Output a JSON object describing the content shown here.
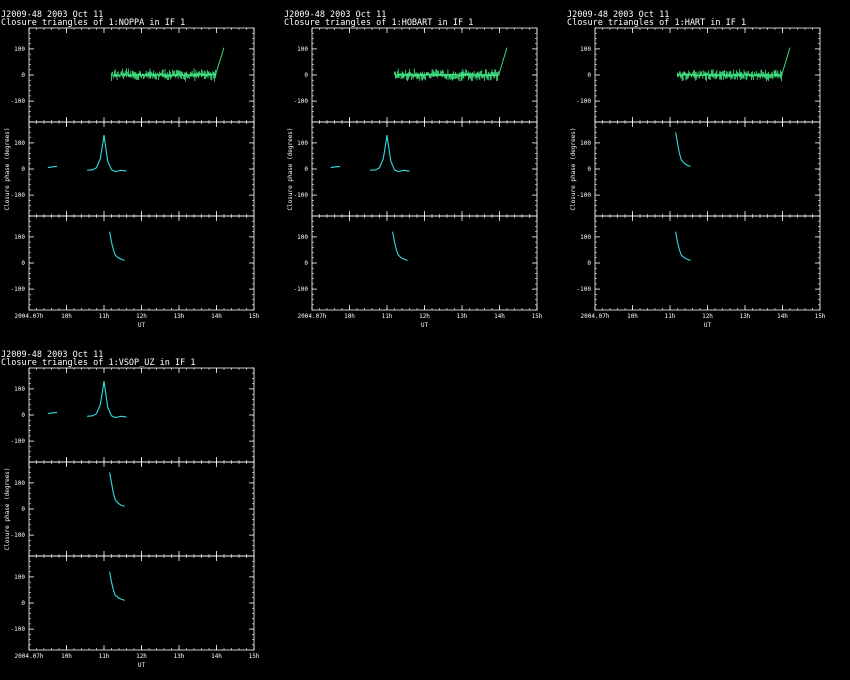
{
  "colors": {
    "background": "#000000",
    "axis": "#ffffff",
    "series_green": "#44ee88",
    "series_cyan": "#33dddd"
  },
  "y_label": "Closure phase  (degrees)",
  "x_label": "UT",
  "x_ticks": [
    {
      "v": 9.0,
      "label": "2004.07h"
    },
    {
      "v": 10.0,
      "label": "10h"
    },
    {
      "v": 11.0,
      "label": "11h"
    },
    {
      "v": 12.0,
      "label": "12h"
    },
    {
      "v": 13.0,
      "label": "13h"
    },
    {
      "v": 14.0,
      "label": "14h"
    },
    {
      "v": 15.0,
      "label": "15h"
    }
  ],
  "y_ticks": [
    100,
    0,
    -100
  ],
  "chart_data": [
    {
      "type": "line",
      "title_line1": "J2009-48   2003 Oct 11",
      "title_line2": "Closure triangles of 1:NOPPA in IF 1",
      "xlim": [
        9.0,
        15.0
      ],
      "ylim": [
        -180,
        180
      ],
      "panels": [
        {
          "label": "",
          "color": "green",
          "series": "noisy_ramp"
        },
        {
          "label": "",
          "color": "cyan",
          "series": "peak"
        },
        {
          "label": "",
          "color": "cyan",
          "series": "decay"
        }
      ]
    },
    {
      "type": "line",
      "title_line1": "J2009-48   2003 Oct 11",
      "title_line2": "Closure triangles of 1:HOBART in IF 1",
      "xlim": [
        9.0,
        15.0
      ],
      "ylim": [
        -180,
        180
      ],
      "panels": [
        {
          "label": "",
          "color": "green",
          "series": "noisy_ramp"
        },
        {
          "label": "",
          "color": "cyan",
          "series": "peak"
        },
        {
          "label": "",
          "color": "cyan",
          "series": "decay"
        }
      ]
    },
    {
      "type": "line",
      "title_line1": "J2009-48   2003 Oct 11",
      "title_line2": "Closure triangles of 1:HART in IF 1",
      "xlim": [
        9.0,
        15.0
      ],
      "ylim": [
        -180,
        180
      ],
      "panels": [
        {
          "label": "",
          "color": "green",
          "series": "noisy_ramp"
        },
        {
          "label": "",
          "color": "cyan",
          "series": "decay_high"
        },
        {
          "label": "",
          "color": "cyan",
          "series": "decay"
        }
      ]
    },
    {
      "type": "line",
      "title_line1": "J2009-48   2003 Oct 11",
      "title_line2": "Closure triangles of 1:VSOP_UZ in IF 1",
      "xlim": [
        9.0,
        15.0
      ],
      "ylim": [
        -180,
        180
      ],
      "panels": [
        {
          "label": "",
          "color": "cyan",
          "series": "peak"
        },
        {
          "label": "",
          "color": "cyan",
          "series": "decay_high"
        },
        {
          "label": "",
          "color": "cyan",
          "series": "decay"
        }
      ]
    }
  ],
  "series_defs": {
    "peak": {
      "segments": [
        [
          [
            9.5,
            5
          ],
          [
            9.6,
            8
          ],
          [
            9.75,
            10
          ]
        ],
        [
          [
            10.55,
            -5
          ],
          [
            10.7,
            -3
          ],
          [
            10.8,
            5
          ],
          [
            10.9,
            40
          ],
          [
            10.97,
            100
          ],
          [
            11.0,
            130
          ],
          [
            11.03,
            100
          ],
          [
            11.1,
            30
          ],
          [
            11.2,
            -3
          ],
          [
            11.3,
            -10
          ],
          [
            11.45,
            -5
          ],
          [
            11.6,
            -8
          ]
        ]
      ]
    },
    "decay": {
      "segments": [
        [
          [
            11.15,
            120
          ],
          [
            11.2,
            80
          ],
          [
            11.25,
            50
          ],
          [
            11.3,
            30
          ],
          [
            11.38,
            20
          ],
          [
            11.45,
            15
          ],
          [
            11.55,
            10
          ]
        ]
      ]
    },
    "decay_high": {
      "segments": [
        [
          [
            11.15,
            140
          ],
          [
            11.2,
            100
          ],
          [
            11.25,
            60
          ],
          [
            11.3,
            35
          ],
          [
            11.38,
            22
          ],
          [
            11.45,
            15
          ],
          [
            11.55,
            10
          ]
        ]
      ]
    },
    "noisy_ramp": {
      "x_start": 11.2,
      "x_end": 14.0,
      "x_spike_end": 14.2,
      "y_spike": 105
    }
  }
}
